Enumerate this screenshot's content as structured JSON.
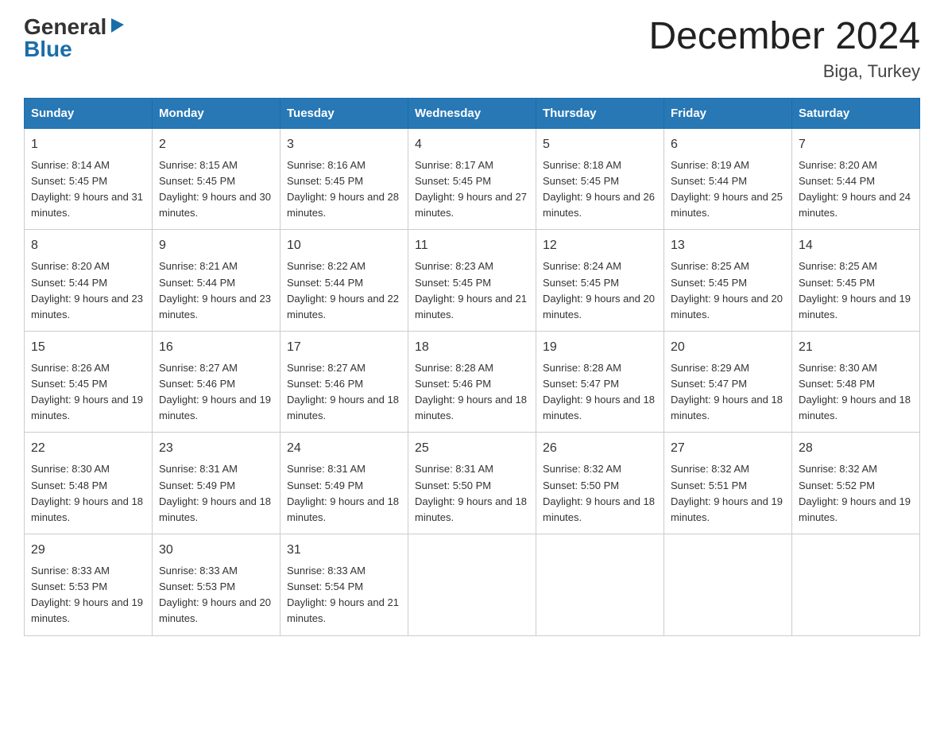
{
  "logo": {
    "general": "General",
    "blue": "Blue",
    "triangle": "▶"
  },
  "title": "December 2024",
  "location": "Biga, Turkey",
  "days_of_week": [
    "Sunday",
    "Monday",
    "Tuesday",
    "Wednesday",
    "Thursday",
    "Friday",
    "Saturday"
  ],
  "weeks": [
    [
      {
        "day": "1",
        "sunrise": "8:14 AM",
        "sunset": "5:45 PM",
        "daylight": "9 hours and 31 minutes."
      },
      {
        "day": "2",
        "sunrise": "8:15 AM",
        "sunset": "5:45 PM",
        "daylight": "9 hours and 30 minutes."
      },
      {
        "day": "3",
        "sunrise": "8:16 AM",
        "sunset": "5:45 PM",
        "daylight": "9 hours and 28 minutes."
      },
      {
        "day": "4",
        "sunrise": "8:17 AM",
        "sunset": "5:45 PM",
        "daylight": "9 hours and 27 minutes."
      },
      {
        "day": "5",
        "sunrise": "8:18 AM",
        "sunset": "5:45 PM",
        "daylight": "9 hours and 26 minutes."
      },
      {
        "day": "6",
        "sunrise": "8:19 AM",
        "sunset": "5:44 PM",
        "daylight": "9 hours and 25 minutes."
      },
      {
        "day": "7",
        "sunrise": "8:20 AM",
        "sunset": "5:44 PM",
        "daylight": "9 hours and 24 minutes."
      }
    ],
    [
      {
        "day": "8",
        "sunrise": "8:20 AM",
        "sunset": "5:44 PM",
        "daylight": "9 hours and 23 minutes."
      },
      {
        "day": "9",
        "sunrise": "8:21 AM",
        "sunset": "5:44 PM",
        "daylight": "9 hours and 23 minutes."
      },
      {
        "day": "10",
        "sunrise": "8:22 AM",
        "sunset": "5:44 PM",
        "daylight": "9 hours and 22 minutes."
      },
      {
        "day": "11",
        "sunrise": "8:23 AM",
        "sunset": "5:45 PM",
        "daylight": "9 hours and 21 minutes."
      },
      {
        "day": "12",
        "sunrise": "8:24 AM",
        "sunset": "5:45 PM",
        "daylight": "9 hours and 20 minutes."
      },
      {
        "day": "13",
        "sunrise": "8:25 AM",
        "sunset": "5:45 PM",
        "daylight": "9 hours and 20 minutes."
      },
      {
        "day": "14",
        "sunrise": "8:25 AM",
        "sunset": "5:45 PM",
        "daylight": "9 hours and 19 minutes."
      }
    ],
    [
      {
        "day": "15",
        "sunrise": "8:26 AM",
        "sunset": "5:45 PM",
        "daylight": "9 hours and 19 minutes."
      },
      {
        "day": "16",
        "sunrise": "8:27 AM",
        "sunset": "5:46 PM",
        "daylight": "9 hours and 19 minutes."
      },
      {
        "day": "17",
        "sunrise": "8:27 AM",
        "sunset": "5:46 PM",
        "daylight": "9 hours and 18 minutes."
      },
      {
        "day": "18",
        "sunrise": "8:28 AM",
        "sunset": "5:46 PM",
        "daylight": "9 hours and 18 minutes."
      },
      {
        "day": "19",
        "sunrise": "8:28 AM",
        "sunset": "5:47 PM",
        "daylight": "9 hours and 18 minutes."
      },
      {
        "day": "20",
        "sunrise": "8:29 AM",
        "sunset": "5:47 PM",
        "daylight": "9 hours and 18 minutes."
      },
      {
        "day": "21",
        "sunrise": "8:30 AM",
        "sunset": "5:48 PM",
        "daylight": "9 hours and 18 minutes."
      }
    ],
    [
      {
        "day": "22",
        "sunrise": "8:30 AM",
        "sunset": "5:48 PM",
        "daylight": "9 hours and 18 minutes."
      },
      {
        "day": "23",
        "sunrise": "8:31 AM",
        "sunset": "5:49 PM",
        "daylight": "9 hours and 18 minutes."
      },
      {
        "day": "24",
        "sunrise": "8:31 AM",
        "sunset": "5:49 PM",
        "daylight": "9 hours and 18 minutes."
      },
      {
        "day": "25",
        "sunrise": "8:31 AM",
        "sunset": "5:50 PM",
        "daylight": "9 hours and 18 minutes."
      },
      {
        "day": "26",
        "sunrise": "8:32 AM",
        "sunset": "5:50 PM",
        "daylight": "9 hours and 18 minutes."
      },
      {
        "day": "27",
        "sunrise": "8:32 AM",
        "sunset": "5:51 PM",
        "daylight": "9 hours and 19 minutes."
      },
      {
        "day": "28",
        "sunrise": "8:32 AM",
        "sunset": "5:52 PM",
        "daylight": "9 hours and 19 minutes."
      }
    ],
    [
      {
        "day": "29",
        "sunrise": "8:33 AM",
        "sunset": "5:53 PM",
        "daylight": "9 hours and 19 minutes."
      },
      {
        "day": "30",
        "sunrise": "8:33 AM",
        "sunset": "5:53 PM",
        "daylight": "9 hours and 20 minutes."
      },
      {
        "day": "31",
        "sunrise": "8:33 AM",
        "sunset": "5:54 PM",
        "daylight": "9 hours and 21 minutes."
      },
      null,
      null,
      null,
      null
    ]
  ]
}
